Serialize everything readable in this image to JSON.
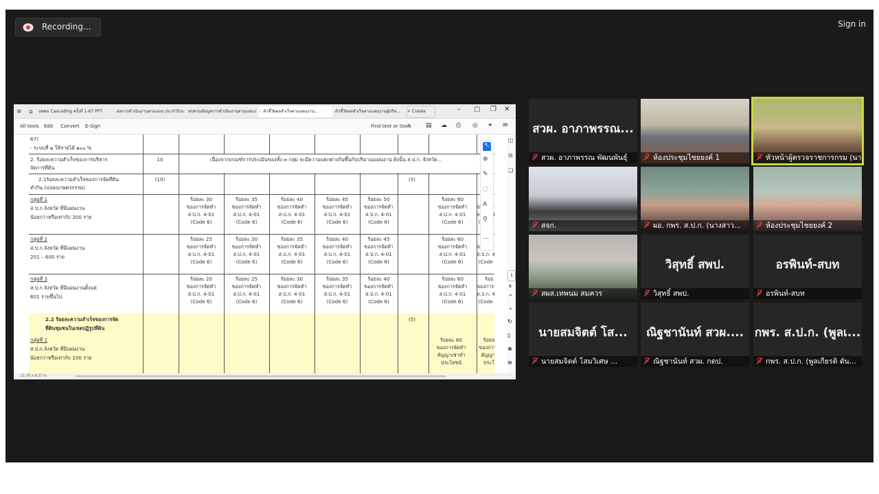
{
  "recording": {
    "label": "Recording..."
  },
  "signin": {
    "label": "Sign in"
  },
  "browser": {
    "tabs": [
      "บทคม Cascading ครั้งที่ 1-67 PPT",
      "ผลการดำเนินงานตามแผน ประจำปีงบ...",
      "ทบทวนข้อมูลการดำเนินงานตามแผนงาน (...",
      "ตัวชี้วัดผลสำเร็จตามแผนงาน...",
      "ตัวชี้วัดผลสำเร็จตามแผนงานผู้บริห..."
    ],
    "new_tab": "+ Create",
    "tools": [
      "All tools",
      "Edit",
      "Convert",
      "E-Sign"
    ],
    "find": "Find text or tools",
    "status": "11.70 x 8.27 in",
    "page_nums": [
      "1",
      "8"
    ]
  },
  "doc": {
    "r0": {
      "c1": "67)",
      "c2": "- ระบบที่ ๒ ให้จ่ายได้ ๑๐๐ %"
    },
    "r1": {
      "c1": "2. ร้อยละความสำเร็จของการบริหาร",
      "c2": "จัดการที่ดิน",
      "w": "10",
      "note": "เนื่องจากเกณฑ์การประเมินของทั้ง ๓ กลุ่ม จะมีความแตกต่างกันขึ้นกับปริมาณแผนงาน ดังนั้น ส.ป.ก. จังหวัด..."
    },
    "r2": {
      "c1": "2.1ร้อยละความสำเร็จของการจัดที่ดิน",
      "c2": "ทำกิน (แปลงเกษตรกรรม)",
      "w": "(10)",
      "s": "(5)"
    },
    "g1": {
      "h": "กลุ่มที่ 1",
      "l1": "ส.ป.ก.จังหวัด ที่มีแผนงาน",
      "l2": "น้อยกว่าหรือเท่ากับ  200  ราย",
      "vals": [
        "ร้อยละ 30",
        "ร้อยละ 35",
        "ร้อยละ 40",
        "ร้อยละ 45",
        "ร้อยละ 50",
        "ร้อยละ 60",
        "ร้อย"
      ]
    },
    "g2": {
      "h": "กลุ่มที่ 2",
      "l1": "ส.ป.ก.จังหวัด ที่มีแผนงาน",
      "l2": "201  –  600  ราย",
      "vals": [
        "ร้อยละ 25",
        "ร้อยละ 30",
        "ร้อยละ 35",
        "ร้อยละ 40",
        "ร้อยละ 45",
        "ร้อยละ 60",
        "ร้อย"
      ]
    },
    "g3": {
      "h": "กลุ่มที่ 3",
      "l1": "ส.ป.ก.จังหวัด ที่มีแผนงานตั้งแต่",
      "l2": "601  รายขึ้นไป",
      "vals": [
        "ร้อยละ 20",
        "ร้อยละ 25",
        "ร้อยละ 30",
        "ร้อยละ 35",
        "ร้อยละ 40",
        "ร้อยละ 60",
        "ร้อย"
      ]
    },
    "sub": [
      "ของการจัดทำ",
      "ส.ป.ก. 4-01",
      "(Code 6)"
    ],
    "r3": {
      "c1": "2.2  ร้อยละความสำเร็จของการจัด",
      "c2": "ที่ดินชุมชนในเขตปฏิรูปที่ดิน",
      "s": "(5)"
    },
    "g4": {
      "h": "กลุ่มที่ 1",
      "l1": "ส.ป.ก.จังหวัด ที่มีแผนงาน",
      "l2": "น้อยกว่าหรือเท่ากับ 100 ราย",
      "v1": [
        "ร้อยละ 60",
        "ของการจัดทำ",
        "สัญญาเช่าทำ",
        "ประโยชน์"
      ],
      "v2": [
        "ร้อยล",
        "ของการจ",
        "สัญญาเ",
        "ประโ"
      ]
    }
  },
  "participants": [
    {
      "big": "สวผ. อาภาพรรณ...",
      "name": "สวผ. อาภาพรรณ  พัฒนพันธุ์"
    },
    {
      "big": "",
      "name": "ห้องประชุมไชยยงค์ 1"
    },
    {
      "big": "",
      "name": "หัวหน้าผู้ตรวจราชการกรม (นา..."
    },
    {
      "big": "",
      "name": "สจก."
    },
    {
      "big": "",
      "name": "ผอ. กพร. ส.ป.ก. (นางสาว..."
    },
    {
      "big": "",
      "name": "ห้องประชุมไชยยงค์ 2"
    },
    {
      "big": "",
      "name": "สผส.เทพนม  สมควร"
    },
    {
      "big": "วิสุทธิ์  สพป.",
      "name": "วิสุทธิ์  สพป."
    },
    {
      "big": "อรพินท์-สบท",
      "name": "อรพินท์-สบท"
    },
    {
      "big": "นายสมจิตต์    โส...",
      "name": "นายสมจิตต์    โสมวิเศษ ..."
    },
    {
      "big": "ณิฐชานันท์ สวผ....",
      "name": "ณิฐชานันท์ สวผ. กตป."
    },
    {
      "big": "กพร. ส.ป.ก. (พูลเ...",
      "name": "กพร. ส.ป.ก. (พูลเกียรติ ตัน..."
    }
  ],
  "colors": {
    "meeting_bg": "#1a1a1a",
    "tile_bg": "#262626",
    "highlight": "#c8d840",
    "mic_off": "#e0393e",
    "doc_yellow": "#fffbc8",
    "active_tool": "#1a73e8"
  }
}
